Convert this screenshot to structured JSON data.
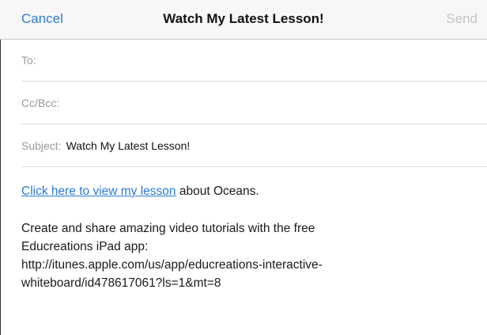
{
  "nav": {
    "cancel_label": "Cancel",
    "title": "Watch My Latest Lesson!",
    "send_label": "Send"
  },
  "fields": {
    "to_label": "To:",
    "to_value": "",
    "cc_label": "Cc/Bcc:",
    "cc_value": "",
    "subject_label": "Subject:",
    "subject_value": "Watch My Latest Lesson!"
  },
  "body": {
    "link_text": "Click here to view my lesson",
    "after_link": " about Oceans.",
    "para_lines": [
      "Create and share amazing video tutorials with the free",
      "Educreations iPad app:",
      "http://itunes.apple.com/us/app/educreations-interactive-",
      "whiteboard/id478617061?ls=1&mt=8"
    ]
  },
  "colors": {
    "accent": "#2f7ed8",
    "disabled": "#c4c4c4",
    "label": "#9a9a9a",
    "link": "#2a7ad4"
  }
}
